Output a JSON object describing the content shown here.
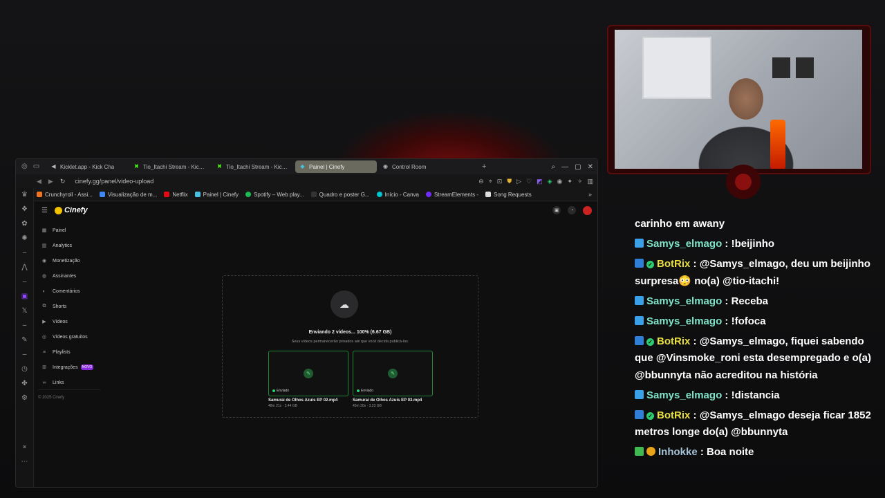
{
  "browser": {
    "tabs": [
      {
        "label": "Kicklet.app - Kick Cha",
        "favicon": "speaker-icon",
        "active": false
      },
      {
        "label": "Tio_Itachi Stream - Kick Ch",
        "favicon": "kick-icon",
        "active": false
      },
      {
        "label": "Tio_Itachi Stream - Kick Ch",
        "favicon": "kick-icon",
        "active": false
      },
      {
        "label": "Painel | Cinefy",
        "favicon": "cinefy-icon",
        "active": true
      },
      {
        "label": "Control Room",
        "favicon": "control-room-icon",
        "active": false
      }
    ],
    "url": "cinefy.gg/panel/video-upload",
    "bookmarks": [
      {
        "label": "Crunchyroll - Assi...",
        "color": "#f47521"
      },
      {
        "label": "Visualização de m...",
        "color": "#4285f4"
      },
      {
        "label": "Netflix",
        "color": "#e50914"
      },
      {
        "label": "Painel | Cinefy",
        "color": "#4ac0e0"
      },
      {
        "label": "Spotify – Web play...",
        "color": "#1db954"
      },
      {
        "label": "Quadro e poster G...",
        "color": "#333333"
      },
      {
        "label": "Início - Canva",
        "color": "#00c4cc"
      },
      {
        "label": "StreamElements -",
        "color": "#6f2cf4"
      },
      {
        "label": "Song Requests",
        "color": "#dddddd"
      }
    ]
  },
  "app": {
    "brand": "Cinefy",
    "menu": [
      {
        "label": "Painel",
        "icon": "grid-icon"
      },
      {
        "label": "Analytics",
        "icon": "bar-chart-icon"
      },
      {
        "label": "Monetização",
        "icon": "dollar-icon"
      },
      {
        "label": "Assinantes",
        "icon": "users-icon"
      },
      {
        "label": "Comentários",
        "icon": "comment-icon"
      },
      {
        "label": "Shorts",
        "icon": "shorts-icon"
      },
      {
        "label": "Vídeos",
        "icon": "video-icon"
      },
      {
        "label": "Vídeos gratuitos",
        "icon": "free-video-icon"
      },
      {
        "label": "Playlists",
        "icon": "playlist-icon"
      },
      {
        "label": "Integrações",
        "icon": "integration-icon",
        "badge": "NOVO"
      },
      {
        "label": "Links",
        "icon": "link-icon"
      }
    ],
    "copyright": "© 2025 Cinefy",
    "upload": {
      "status": "Enviando 2 vídeos... 100% (6.67 GB)",
      "note": "Seus vídeos permanecerão privados até que você decida publicá-los.",
      "videos": [
        {
          "name": "Samurai de Olhos Azuis EP 02.mp4",
          "meta": "48m 21s · 3.44 GB",
          "status": "Enviado"
        },
        {
          "name": "Samurai de Olhos Azuis EP 03.mp4",
          "meta": "45m 30s · 3.23 GB",
          "status": "Enviado"
        }
      ]
    }
  },
  "chat": {
    "messages": [
      {
        "user": "",
        "text": "carinho em awany",
        "type": "cont"
      },
      {
        "user": "Samys_elmago",
        "text": "!beijinho",
        "type": "samys"
      },
      {
        "user": "BotRix",
        "text": "@Samys_elmago, deu um beijinho surpresa😳 no(a) @tio-itachi!",
        "type": "botrix"
      },
      {
        "user": "Samys_elmago",
        "text": "Receba",
        "type": "samys"
      },
      {
        "user": "Samys_elmago",
        "text": "!fofoca",
        "type": "samys"
      },
      {
        "user": "BotRix",
        "text": "@Samys_elmago, fiquei sabendo que @Vinsmoke_roni esta desempregado e o(a) @bbunnyta não acreditou na história",
        "type": "botrix"
      },
      {
        "user": "Samys_elmago",
        "text": "!distancia",
        "type": "samys"
      },
      {
        "user": "BotRix",
        "text": "@Samys_elmago deseja ficar 1852 metros longe do(a) @bbunnyta",
        "type": "botrix"
      },
      {
        "user": "Inhokke",
        "text": "Boa noite",
        "type": "inhokke"
      }
    ]
  }
}
